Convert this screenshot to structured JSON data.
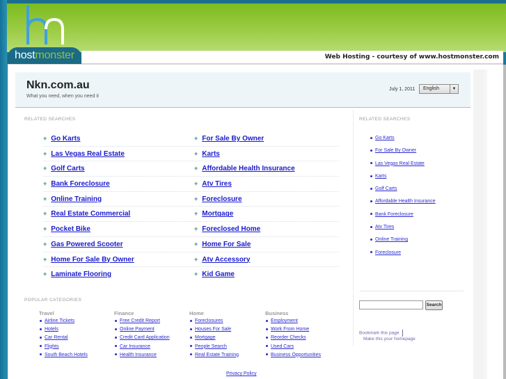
{
  "branding": {
    "logo_host": "host",
    "logo_monster": "monster",
    "courtesy": "Web Hosting - courtesy of www.hostmonster.com"
  },
  "header": {
    "title": "Nkn.com.au",
    "tagline": "What you need, when you need it",
    "date": "July 1, 2011",
    "language": "English"
  },
  "related_label": "RELATED SEARCHES",
  "main_searches": {
    "col1": [
      "Go Karts",
      "Las Vegas Real Estate",
      "Golf Carts",
      "Bank Foreclosure",
      "Online Training",
      "Real Estate Commercial",
      "Pocket Bike",
      "Gas Powered Scooter",
      "Home For Sale By Owner",
      "Laminate Flooring"
    ],
    "col2": [
      "For Sale By Owner",
      "Karts",
      "Affordable Health Insurance",
      "Atv Tires",
      "Foreclosure",
      "Mortgage",
      "Foreclosed Home",
      "Home For Sale",
      "Atv Accessory",
      "Kid Game"
    ]
  },
  "sidebar": {
    "label": "RELATED SEARCHES",
    "items": [
      "Go Karts",
      "For Sale By Owner",
      "Las Vegas Real Estate",
      "Karts",
      "Golf Carts",
      "Affordable Health Insurance",
      "Bank Foreclosure",
      "Atv Tires",
      "Online Training",
      "Foreclosure"
    ],
    "search_button": "Search",
    "search_value": "",
    "bookmark": "Bookmark this page",
    "homepage": "Make this your homepage"
  },
  "popular": {
    "label": "POPULAR CATEGORIES",
    "columns": [
      {
        "heading": "Travel",
        "items": [
          "Airline Tickets",
          "Hotels",
          "Car Rental",
          "Flights",
          "South Beach Hotels"
        ]
      },
      {
        "heading": "Finance",
        "items": [
          "Free Credit Report",
          "Online Payment",
          "Credit Card Application",
          "Car Insurance",
          "Health Insurance"
        ]
      },
      {
        "heading": "Home",
        "items": [
          "Foreclosures",
          "Houses For Sale",
          "Mortgage",
          "People Search",
          "Real Estate Training"
        ]
      },
      {
        "heading": "Business",
        "items": [
          "Employment",
          "Work From Home",
          "Reorder Checks",
          "Used Cars",
          "Business Opportunities"
        ]
      }
    ]
  },
  "footer": {
    "privacy": "Privacy Policy"
  },
  "colors": {
    "brand_blue": "#1b6a86",
    "brand_green": "#8dc63f",
    "link": "#1a1acc"
  }
}
